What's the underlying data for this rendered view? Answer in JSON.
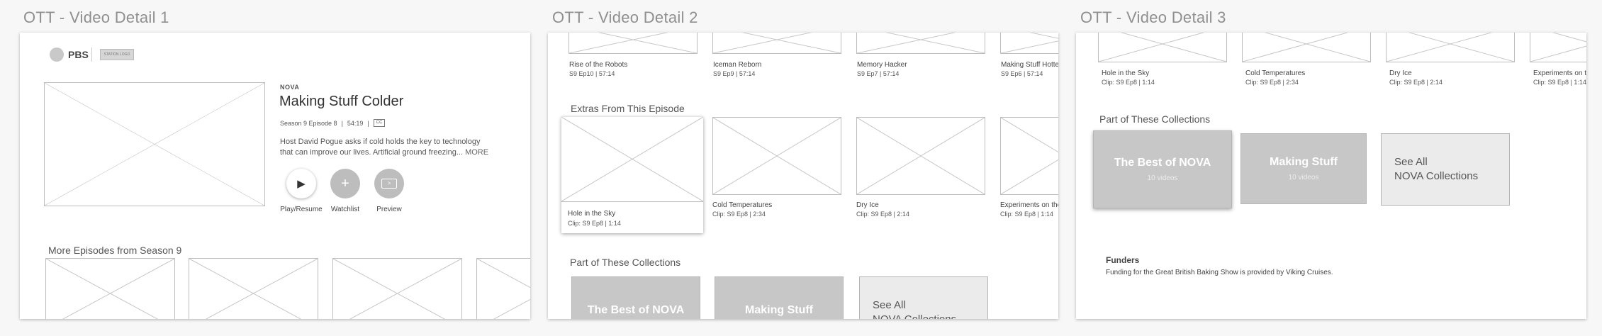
{
  "boards": [
    {
      "title": "OTT - Video Detail 1"
    },
    {
      "title": "OTT - Video Detail 2"
    },
    {
      "title": "OTT - Video Detail 3"
    }
  ],
  "detail1": {
    "logo": "PBS",
    "station_logo_text": "STATION LOGO",
    "series": "NOVA",
    "episode_title": "Making Stuff Colder",
    "meta": {
      "season_episode": "Season 9 Episode 8",
      "duration": "54:19",
      "cc": "CC"
    },
    "description": "Host David Pogue asks if cold holds the key to technology that can improve our lives. Artificial ground freezing...",
    "more": "MORE",
    "actions": [
      {
        "label": "Play/Resume",
        "icon": "play-icon",
        "glyph": "▶"
      },
      {
        "label": "Watchlist",
        "icon": "plus-icon",
        "glyph": "+"
      },
      {
        "label": "Preview",
        "icon": "preview-icon",
        "glyph": ">"
      }
    ],
    "more_episodes_heading": "More Episodes from Season 9"
  },
  "detail2": {
    "top_episodes": [
      {
        "title": "Rise of the Robots",
        "sub": "S9 Ep10 | 57:14"
      },
      {
        "title": "Iceman Reborn",
        "sub": "S9 Ep9 | 57:14"
      },
      {
        "title": "Memory Hacker",
        "sub": "S9 Ep7 | 57:14"
      },
      {
        "title": "Making Stuff Hotter",
        "sub": "S9 Ep6 | 57:14"
      }
    ],
    "extras_heading": "Extras From This Episode",
    "extras": [
      {
        "title": "Hole in the Sky",
        "sub": "Clip: S9 Ep8 | 1:14"
      },
      {
        "title": "Cold Temperatures",
        "sub": "Clip: S9 Ep8 | 2:34"
      },
      {
        "title": "Dry Ice",
        "sub": "Clip: S9 Ep8 | 2:14"
      },
      {
        "title": "Experiments on the Ice",
        "sub": "Clip: S9 Ep8 | 1:14"
      }
    ],
    "collections_heading": "Part of These Collections",
    "collections": [
      {
        "title": "The Best of NOVA"
      },
      {
        "title": "Making Stuff"
      },
      {
        "title": "See All\nNOVA Collections"
      }
    ]
  },
  "detail3": {
    "clips": [
      {
        "title": "Hole in the Sky",
        "sub": "Clip: S9 Ep8 | 1:14"
      },
      {
        "title": "Cold Temperatures",
        "sub": "Clip: S9 Ep8 | 2:34"
      },
      {
        "title": "Dry Ice",
        "sub": "Clip: S9 Ep8 | 2:14"
      },
      {
        "title": "Experiments on the Ice",
        "sub": "Clip: S9 Ep8 | 1:14"
      }
    ],
    "collections_heading": "Part of These Collections",
    "collections": [
      {
        "title": "The Best of NOVA",
        "sub": "10 videos"
      },
      {
        "title": "Making Stuff",
        "sub": "10 videos"
      },
      {
        "title": "See All\nNOVA Collections"
      }
    ],
    "funders_heading": "Funders",
    "funders_text": "Funding for the Great British Baking Show is provided by Viking Cruises."
  }
}
